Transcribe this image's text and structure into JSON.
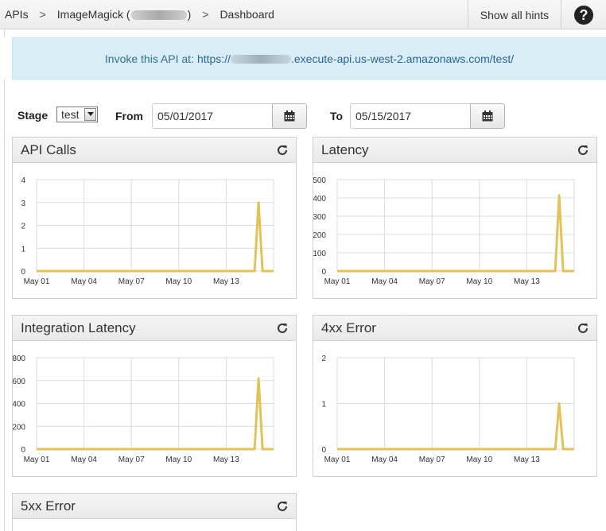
{
  "breadcrumb": {
    "items": [
      "APIs",
      "ImageMagick (",
      ")",
      "Dashboard"
    ],
    "separator": ">"
  },
  "header": {
    "show_hints_label": "Show all hints",
    "help_icon": "question-circle-icon"
  },
  "banner": {
    "text": "Invoke this API at:",
    "url_prefix": "https://",
    "url_suffix": ".execute-api.us-west-2.amazonaws.com/test/"
  },
  "filters": {
    "stage_label": "Stage",
    "stage_value": "test",
    "from_label": "From",
    "from_value": "05/01/2017",
    "to_label": "To",
    "to_value": "05/15/2017",
    "calendar_icon": "calendar-icon"
  },
  "colors": {
    "line": "#e3c25a",
    "banner_bg": "#d9edf7",
    "banner_text": "#31708f"
  },
  "panels": [
    {
      "title": "API Calls"
    },
    {
      "title": "Latency"
    },
    {
      "title": "Integration Latency"
    },
    {
      "title": "4xx Error"
    },
    {
      "title": "5xx Error"
    }
  ],
  "chart_data": [
    {
      "type": "line",
      "title": "API Calls",
      "xticks": [
        "May 01",
        "May 04",
        "May 07",
        "May 10",
        "May 13"
      ],
      "yticks": [
        0,
        1,
        2,
        3,
        4
      ],
      "ylim": [
        0,
        4
      ],
      "x_day_range": [
        1,
        16
      ],
      "x": [
        1,
        14.8,
        15.05,
        15.3,
        16
      ],
      "values": [
        0,
        0,
        3,
        0,
        0
      ],
      "grid": true
    },
    {
      "type": "line",
      "title": "Latency",
      "xticks": [
        "May 01",
        "May 04",
        "May 07",
        "May 10",
        "May 13"
      ],
      "yticks": [
        0,
        100,
        200,
        300,
        400,
        500
      ],
      "ylim": [
        0,
        500
      ],
      "x_day_range": [
        1,
        16
      ],
      "x": [
        1,
        14.8,
        15.05,
        15.3,
        16
      ],
      "values": [
        0,
        0,
        415,
        0,
        0
      ],
      "grid": true
    },
    {
      "type": "line",
      "title": "Integration Latency",
      "xticks": [
        "May 01",
        "May 04",
        "May 07",
        "May 10",
        "May 13"
      ],
      "yticks": [
        0,
        200,
        400,
        600,
        800
      ],
      "ylim": [
        0,
        800
      ],
      "x_day_range": [
        1,
        16
      ],
      "x": [
        1,
        14.8,
        15.05,
        15.3,
        16
      ],
      "values": [
        0,
        0,
        620,
        0,
        0
      ],
      "grid": true
    },
    {
      "type": "line",
      "title": "4xx Error",
      "xticks": [
        "May 01",
        "May 04",
        "May 07",
        "May 10",
        "May 13"
      ],
      "yticks": [
        0,
        1,
        2
      ],
      "ylim": [
        0,
        2
      ],
      "x_day_range": [
        1,
        16
      ],
      "x": [
        1,
        14.8,
        15.05,
        15.3,
        16
      ],
      "values": [
        0,
        0,
        1,
        0,
        0
      ],
      "grid": true
    }
  ]
}
